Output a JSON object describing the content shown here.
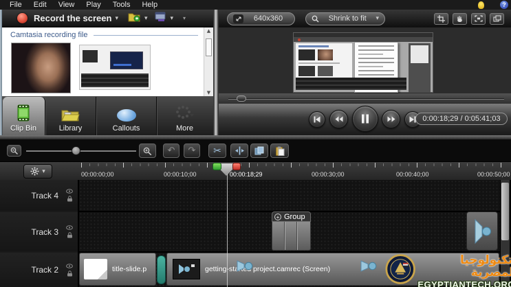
{
  "colors": {
    "record_red": "#e0503c",
    "clip_bin_header_blue": "#3c5a8a",
    "tool_icon_blue": "#9fc0dc",
    "teal_transition": "#2f9385",
    "playhead_in_green": "#3fae3a",
    "playhead_out_red": "#d0392e",
    "watermark_orange": "#ef8a12"
  },
  "menu_bar": {
    "items": [
      {
        "label": "File"
      },
      {
        "label": "Edit"
      },
      {
        "label": "View"
      },
      {
        "label": "Play"
      },
      {
        "label": "Tools"
      },
      {
        "label": "Help"
      }
    ],
    "help_glyph": "?"
  },
  "record_toolbar": {
    "record_label": "Record the screen"
  },
  "clip_bin": {
    "header": "Camtasia recording file"
  },
  "tabs": [
    {
      "label": "Clip Bin",
      "active": true
    },
    {
      "label": "Library",
      "active": false
    },
    {
      "label": "Callouts",
      "active": false
    },
    {
      "label": "More",
      "active": false
    }
  ],
  "preview": {
    "size_label": "640x360",
    "zoom_mode": "Shrink to fit",
    "time_display": "0:00:18;29 / 0:05:41;03"
  },
  "timeline": {
    "ruler_labels": [
      {
        "text": "00:00:00;00"
      },
      {
        "text": "00:00:10;00"
      },
      {
        "text": "00:00:18;29"
      },
      {
        "text": "00:00:30;00"
      },
      {
        "text": "00:00:40;00"
      },
      {
        "text": "00:00:50;00"
      }
    ],
    "tracks": [
      {
        "name": "Track 4"
      },
      {
        "name": "Track 3"
      },
      {
        "name": "Track 2"
      }
    ],
    "group_clip_label": "Group",
    "group_expand_glyph": "+",
    "clips": [
      {
        "label": "title-slide.p",
        "track": "Track 2"
      },
      {
        "label": "getting-started project.camrec (Screen)",
        "track": "Track 2"
      }
    ]
  },
  "icons": {
    "caret": "▾",
    "scroll_up": "▲",
    "scroll_down": "▼",
    "scissors": "✂",
    "undo": "↶",
    "redo": "↷"
  },
  "watermark": {
    "arabic_text": "لتكنولوجيا المصرية",
    "site_text": "EGYPTIANTECH.ORG"
  }
}
